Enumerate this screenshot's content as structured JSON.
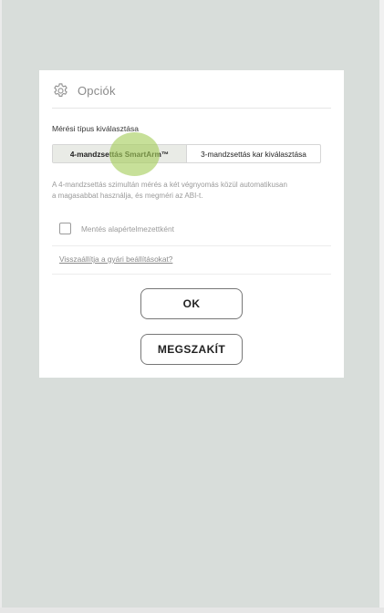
{
  "dialog": {
    "title": "Opciók",
    "title_icon": "gear-icon",
    "section_label": "Mérési típus kiválasztása",
    "segments": [
      {
        "label": "4-mandzsettás SmartArm™",
        "selected": true
      },
      {
        "label": "3-mandzsettás kar kiválasztása",
        "selected": false
      }
    ],
    "description_line1": "A 4-mandzsettás szimultán mérés a két végnyomás közül automatikusan",
    "description_line2": "a magasabbat használja, és megméri az ABI-t.",
    "checkbox": {
      "label": "Mentés alapértelmezettként",
      "checked": false
    },
    "reset_link": "Visszaállítja a gyári beállításokat?",
    "ok_label": "OK",
    "cancel_label": "MEGSZAKÍT"
  },
  "colors": {
    "background": "#d8ddda",
    "dialog": "#ffffff",
    "touch_indicator": "#a5cd5a"
  }
}
